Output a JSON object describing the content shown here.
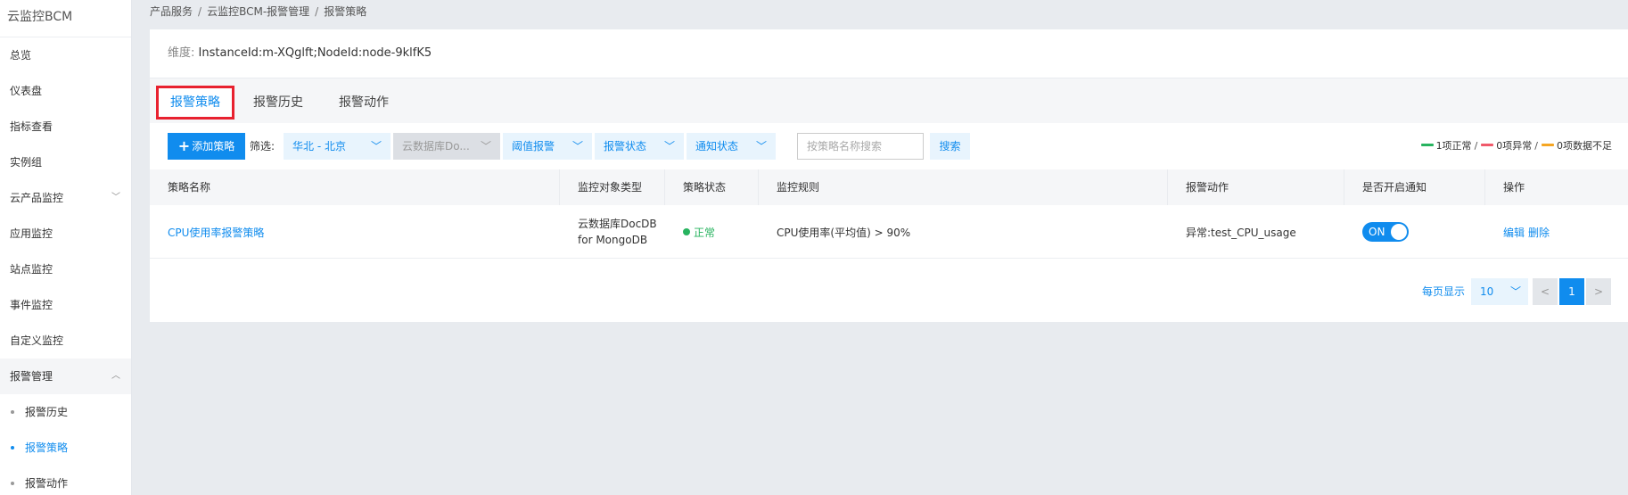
{
  "sidebar": {
    "title": "云监控BCM",
    "items": [
      {
        "label": "总览"
      },
      {
        "label": "仪表盘"
      },
      {
        "label": "指标查看"
      },
      {
        "label": "实例组"
      },
      {
        "label": "云产品监控",
        "chevron": "chevron-down-icon"
      },
      {
        "label": "应用监控"
      },
      {
        "label": "站点监控"
      },
      {
        "label": "事件监控"
      },
      {
        "label": "自定义监控"
      },
      {
        "label": "报警管理",
        "chevron": "chevron-up-icon"
      }
    ],
    "sub_items": [
      {
        "label": "报警历史",
        "active": false
      },
      {
        "label": "报警策略",
        "active": true
      },
      {
        "label": "报警动作",
        "active": false
      }
    ]
  },
  "breadcrumb": [
    "产品服务",
    "云监控BCM-报警管理",
    "报警策略"
  ],
  "breadcrumb_sep": "/",
  "dimension": {
    "key": "维度:",
    "value": "InstanceId:m-XQglft;NodeId:node-9klfK5"
  },
  "tabs": [
    {
      "label": "报警策略",
      "active": true
    },
    {
      "label": "报警历史",
      "active": false
    },
    {
      "label": "报警动作",
      "active": false
    }
  ],
  "toolbar": {
    "add_label": "添加策略",
    "filter_label": "筛选:",
    "region": "华北 - 北京",
    "product_type": "云数据库Do...",
    "threshold": "阈值报警",
    "alarm_state": "报警状态",
    "notify_state": "通知状态",
    "search_placeholder": "按策略名称搜索",
    "search_label": "搜索"
  },
  "legend": {
    "normal": "1项正常",
    "abnormal": "0项异常",
    "insufficient": "0项数据不足",
    "sep": "/",
    "colors": {
      "normal": "#27b35f",
      "abnormal": "#f0596a",
      "insufficient": "#f5a623"
    }
  },
  "table": {
    "headers": [
      "策略名称",
      "监控对象类型",
      "策略状态",
      "监控规则",
      "报警动作",
      "是否开启通知",
      "操作"
    ],
    "rows": [
      {
        "name": "CPU使用率报警策略",
        "object_type_line1": "云数据库DocDB",
        "object_type_line2": "for MongoDB",
        "status": "正常",
        "status_color": "#27b35f",
        "rule": "CPU使用率(平均值) > 90%",
        "action": "异常:test_CPU_usage",
        "notify": "ON",
        "op_edit": "编辑",
        "op_delete": "删除"
      }
    ]
  },
  "pagination": {
    "per_page_label": "每页显示",
    "per_page": "10",
    "prev": "<",
    "current": "1",
    "next": ">"
  }
}
